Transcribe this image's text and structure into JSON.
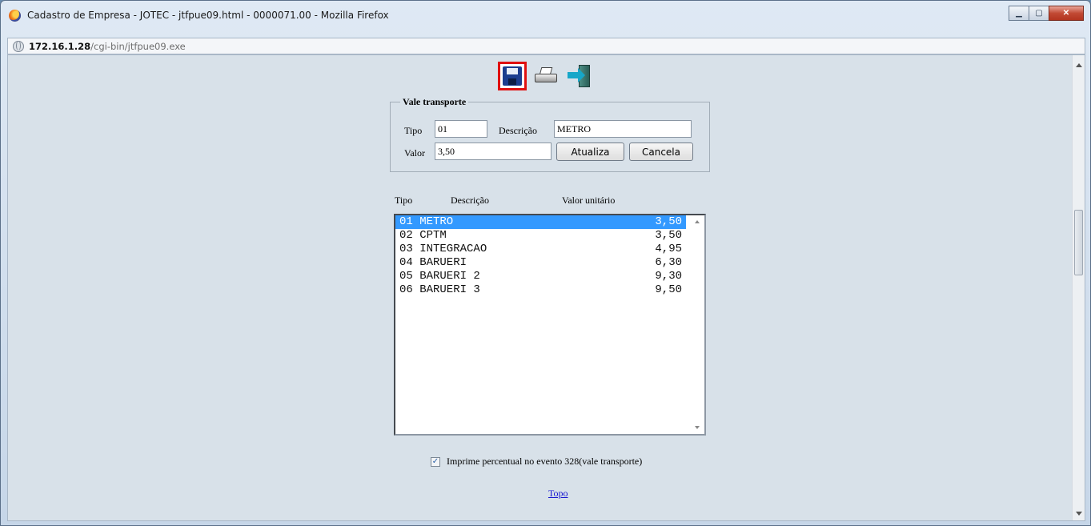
{
  "window": {
    "title": "Cadastro de Empresa - JOTEC - jtfpue09.html - 0000071.00 - Mozilla Firefox",
    "url_host": "172.16.1.28",
    "url_path": "/cgi-bin/jtfpue09.exe",
    "controls": {
      "minimize": "▁",
      "maximize": "▢",
      "close": "✕"
    }
  },
  "toolbar": {
    "icons": [
      "save-icon",
      "print-icon",
      "exit-icon"
    ],
    "highlight_color": "#e01010"
  },
  "form": {
    "legend": "Vale transporte",
    "tipo_label": "Tipo",
    "tipo_value": "01",
    "descricao_label": "Descrição",
    "descricao_value": "METRO",
    "valor_label": "Valor",
    "valor_value": "3,50",
    "atualiza_label": "Atualiza",
    "cancela_label": "Cancela"
  },
  "list": {
    "headers": {
      "tipo": "Tipo",
      "descricao": "Descrição",
      "valor": "Valor unitário"
    },
    "selected_color": "#3399ff",
    "rows": [
      {
        "text": "01 METRO",
        "value": "3,50",
        "selected": true
      },
      {
        "text": "02 CPTM",
        "value": "3,50",
        "selected": false
      },
      {
        "text": "03 INTEGRACAO",
        "value": "4,95",
        "selected": false
      },
      {
        "text": "04 BARUERI",
        "value": "6,30",
        "selected": false
      },
      {
        "text": "05 BARUERI 2",
        "value": "9,30",
        "selected": false
      },
      {
        "text": "06 BARUERI 3",
        "value": "9,50",
        "selected": false
      }
    ]
  },
  "options": {
    "imprime_checked": true,
    "imprime_label": "Imprime percentual no evento 328(vale transporte)"
  },
  "footer": {
    "topo_link": "Topo"
  }
}
